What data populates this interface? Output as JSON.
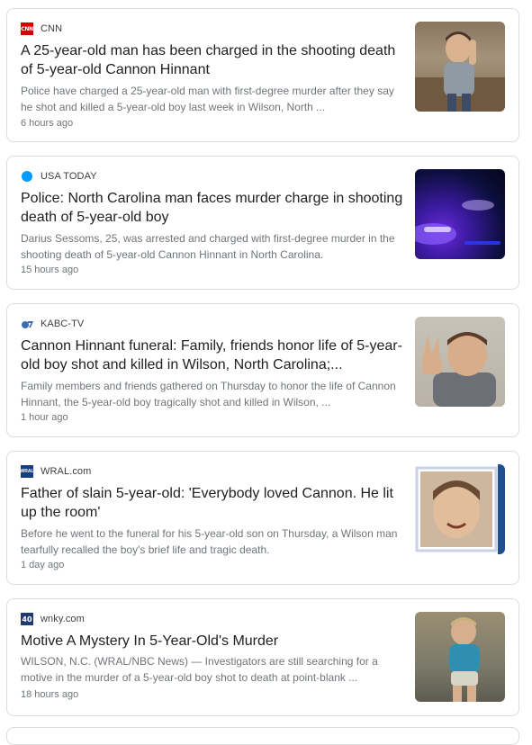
{
  "articles": [
    {
      "source": "CNN",
      "logo": "cnn-logo",
      "logo_text": "CNN",
      "headline": "A 25-year-old man has been charged in the shooting death of 5-year-old Cannon Hinnant",
      "snippet": "Police have charged a 25-year-old man with first-degree murder after they say he shot and killed a 5-year-old boy last week in Wilson, North ...",
      "time": "6 hours ago"
    },
    {
      "source": "USA TODAY",
      "logo": "usa-today-logo",
      "headline": "Police: North Carolina man faces murder charge in shooting death of 5-year-old boy",
      "snippet": "Darius Sessoms, 25, was arrested and charged with first-degree murder in the shooting death of 5-year-old Cannon Hinnant in North Carolina.",
      "time": "15 hours ago"
    },
    {
      "source": "KABC-TV",
      "logo": "abc7-logo",
      "headline": "Cannon Hinnant funeral: Family, friends honor life of 5-year-old boy shot and killed in Wilson, North Carolina;...",
      "snippet": "Family members and friends gathered on Thursday to honor the life of Cannon Hinnant, the 5-year-old boy tragically shot and killed in Wilson, ...",
      "time": "1 hour ago"
    },
    {
      "source": "WRAL.com",
      "logo": "wral-logo",
      "logo_text": "WRAL",
      "headline": "Father of slain 5-year-old: 'Everybody loved Cannon. He lit up the room'",
      "snippet": "Before he went to the funeral for his 5-year-old son on Thursday, a Wilson man tearfully recalled the boy's brief life and tragic death.",
      "time": "1 day ago"
    },
    {
      "source": "wnky.com",
      "logo": "wnky-40-logo",
      "logo_text": "40",
      "headline": "Motive A Mystery In 5-Year-Old's Murder",
      "snippet": "WILSON, N.C. (WRAL/NBC News) — Investigators are still searching for a motive in the murder of a 5-year-old boy shot to death at point-blank ...",
      "time": "18 hours ago"
    }
  ]
}
